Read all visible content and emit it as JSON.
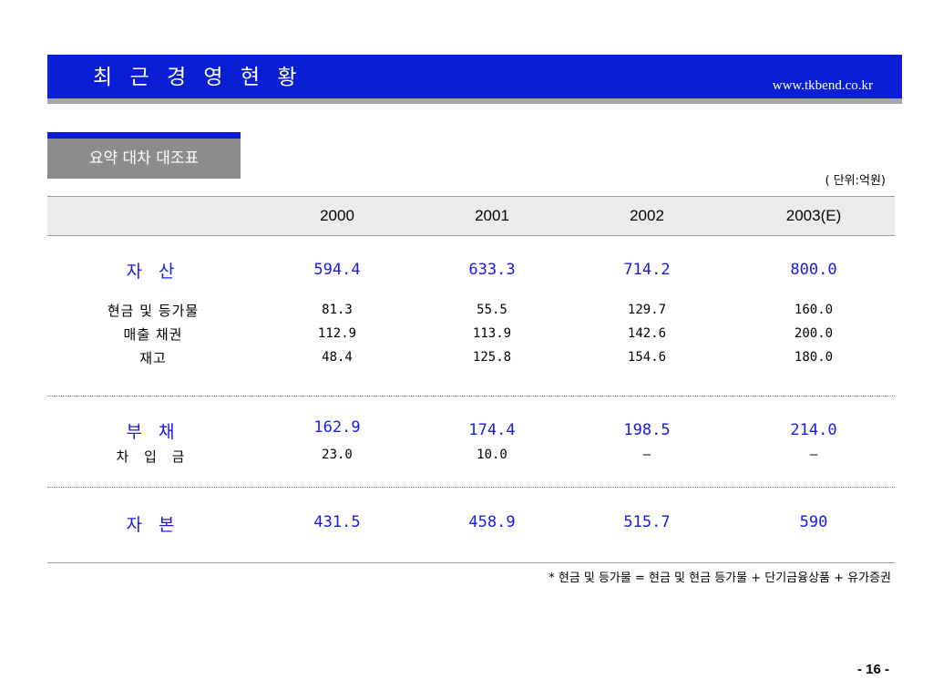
{
  "header": {
    "title": "최 근 경 영 현 황",
    "url": "www.tkbend.co.kr"
  },
  "section": {
    "tab_label": "요약 대차 대조표",
    "unit_note": "( 단위:억원)"
  },
  "table": {
    "columns": [
      "2000",
      "2001",
      "2002",
      "2003(E)"
    ],
    "assets": {
      "label": "자 산",
      "values": [
        "594.4",
        "633.3",
        "714.2",
        "800.0"
      ],
      "items": [
        {
          "label": "현금 및 등가물",
          "values": [
            "81.3",
            "55.5",
            "129.7",
            "160.0"
          ]
        },
        {
          "label": "매출 채권",
          "values": [
            "112.9",
            "113.9",
            "142.6",
            "200.0"
          ]
        },
        {
          "label": "재고",
          "values": [
            "48.4",
            "125.8",
            "154.6",
            "180.0"
          ]
        }
      ]
    },
    "liabilities": {
      "label": "부 채",
      "values": [
        "162.9",
        "174.4",
        "198.5",
        "214.0"
      ],
      "items": [
        {
          "label": "차 입 금",
          "values": [
            "23.0",
            "10.0",
            "–",
            "–"
          ]
        }
      ]
    },
    "equity": {
      "label": "자 본",
      "values": [
        "431.5",
        "458.9",
        "515.7",
        "590"
      ]
    }
  },
  "footnote": "* 현금 및 등가물 = 현금 및 현금 등가물 + 단기금융상품 + 유가증권",
  "page_number": "- 16 -",
  "colors": {
    "title_bar": "#0a1ed6",
    "accent_text": "#1a1ae6",
    "tab_gray": "#8c8c8c",
    "header_row_bg": "#ebebeb"
  }
}
